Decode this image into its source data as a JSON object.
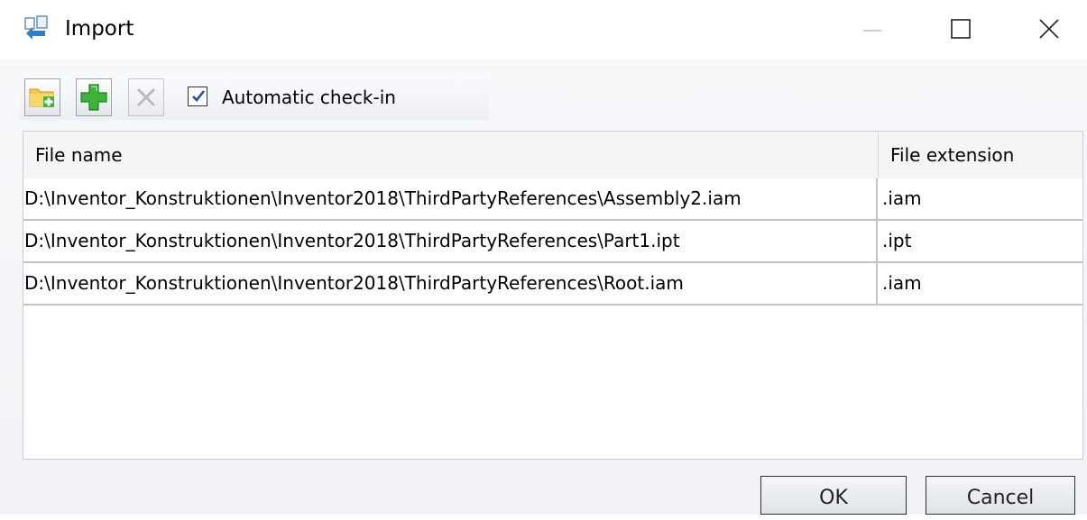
{
  "window": {
    "title": "Import",
    "app_icon": "import-icon",
    "controls": [
      "minimize-icon",
      "maximize-icon",
      "close-icon"
    ]
  },
  "toolbar": {
    "buttons": [
      {
        "icon": "add-folder-icon",
        "enabled": true
      },
      {
        "icon": "add-file-icon",
        "enabled": true
      },
      {
        "icon": "remove-icon",
        "enabled": false
      }
    ],
    "automatic_checkin_label": "Automatic check-in",
    "automatic_checkin_checked": true
  },
  "table": {
    "columns": [
      "File name",
      "File extension"
    ],
    "rows": [
      {
        "file_name": "D:\\Inventor_Konstruktionen\\Inventor2018\\ThirdPartyReferences\\Assembly2.iam",
        "extension": ".iam"
      },
      {
        "file_name": "D:\\Inventor_Konstruktionen\\Inventor2018\\ThirdPartyReferences\\Part1.ipt",
        "extension": ".ipt"
      },
      {
        "file_name": "D:\\Inventor_Konstruktionen\\Inventor2018\\ThirdPartyReferences\\Root.iam",
        "extension": ".iam"
      }
    ]
  },
  "footer": {
    "ok_label": "OK",
    "cancel_label": "Cancel"
  },
  "colors": {
    "add_green": "#3cb43c",
    "folder_yellow": "#f2c84b",
    "checkmark_blue": "#1f4fa8"
  }
}
